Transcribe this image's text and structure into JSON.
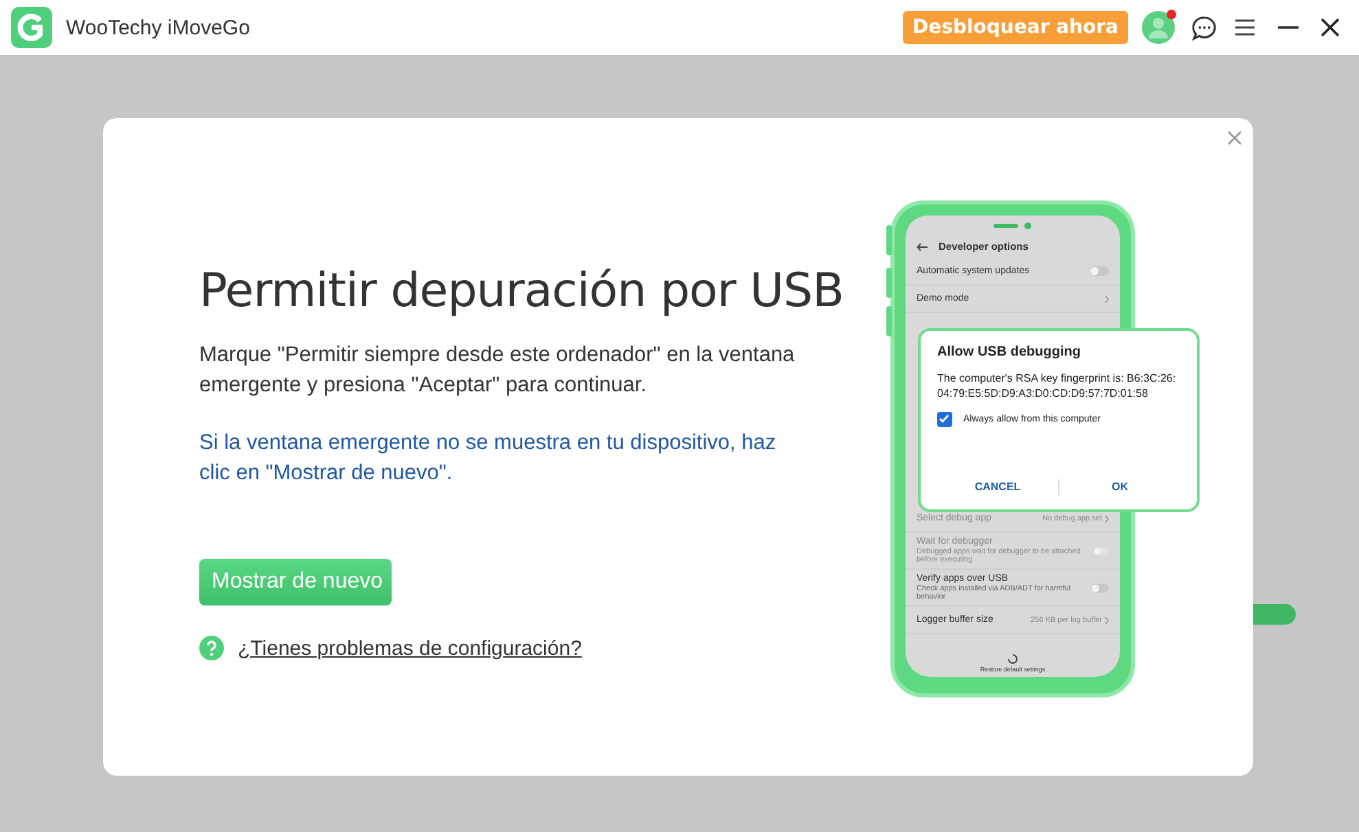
{
  "app": {
    "title": "WooTechy iMoveGo",
    "unlock_button": "Desbloquear ahora",
    "has_notification": true
  },
  "dialog": {
    "title": "Permitir depuración por USB",
    "instruction": "Marque \"Permitir siempre desde este ordenador\" en la ventana emergente y presiona \"Aceptar\" para continuar.",
    "hint": "Si la ventana emergente no se muestra en tu dispositivo, haz clic en \"Mostrar de nuevo\".",
    "show_again_button": "Mostrar de nuevo",
    "help_link": "¿Tienes problemas de configuración?"
  },
  "phone": {
    "screen_title": "Developer options",
    "top_rows": [
      {
        "kind": "toggle",
        "label": "Automatic system updates",
        "on": false,
        "disabled": false
      },
      {
        "kind": "link",
        "label": "Demo mode",
        "disabled": false
      }
    ],
    "bottom_rows": [
      {
        "kind": "link",
        "label": "Select debug app",
        "value": "No debug app set",
        "disabled": true
      },
      {
        "kind": "toggle",
        "label": "Wait for debugger",
        "description": "Debugged apps wait for debugger to be attached before executing",
        "on": false,
        "disabled": true
      },
      {
        "kind": "toggle",
        "label": "Verify apps over USB",
        "description": "Check apps installed via ADB/ADT for harmful behavior",
        "on": false,
        "disabled": false
      },
      {
        "kind": "link",
        "label": "Logger buffer size",
        "value": "256 KB per log buffer",
        "disabled": false
      }
    ],
    "restore_label": "Restore default settings",
    "popup": {
      "title": "Allow USB debugging",
      "message": "The computer's RSA key fingerprint is: B6:3C:26:04:79:E5:5D:D9:A3:D0:CD:D9:57:7D:01:58",
      "checkbox_label": "Always allow from this computer",
      "checked": true,
      "cancel": "CANCEL",
      "ok": "OK"
    }
  }
}
